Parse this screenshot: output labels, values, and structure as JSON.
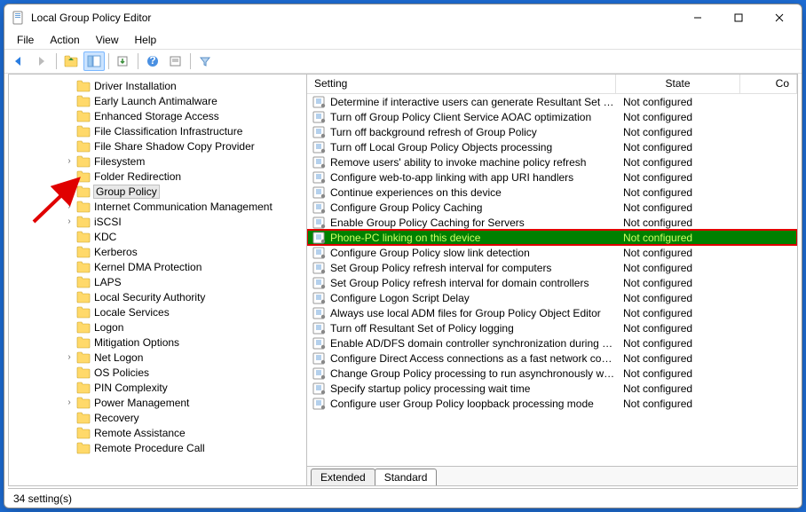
{
  "window": {
    "title": "Local Group Policy Editor"
  },
  "menubar": [
    "File",
    "Action",
    "View",
    "Help"
  ],
  "tree": {
    "items": [
      {
        "label": "Driver Installation",
        "exp": ""
      },
      {
        "label": "Early Launch Antimalware",
        "exp": ""
      },
      {
        "label": "Enhanced Storage Access",
        "exp": ""
      },
      {
        "label": "File Classification Infrastructure",
        "exp": ""
      },
      {
        "label": "File Share Shadow Copy Provider",
        "exp": ""
      },
      {
        "label": "Filesystem",
        "exp": ">"
      },
      {
        "label": "Folder Redirection",
        "exp": ""
      },
      {
        "label": "Group Policy",
        "exp": "",
        "selected": true
      },
      {
        "label": "Internet Communication Management",
        "exp": ">"
      },
      {
        "label": "iSCSI",
        "exp": ">"
      },
      {
        "label": "KDC",
        "exp": ""
      },
      {
        "label": "Kerberos",
        "exp": ""
      },
      {
        "label": "Kernel DMA Protection",
        "exp": ""
      },
      {
        "label": "LAPS",
        "exp": ""
      },
      {
        "label": "Local Security Authority",
        "exp": ""
      },
      {
        "label": "Locale Services",
        "exp": ""
      },
      {
        "label": "Logon",
        "exp": ""
      },
      {
        "label": "Mitigation Options",
        "exp": ""
      },
      {
        "label": "Net Logon",
        "exp": ">"
      },
      {
        "label": "OS Policies",
        "exp": ""
      },
      {
        "label": "PIN Complexity",
        "exp": ""
      },
      {
        "label": "Power Management",
        "exp": ">"
      },
      {
        "label": "Recovery",
        "exp": ""
      },
      {
        "label": "Remote Assistance",
        "exp": ""
      },
      {
        "label": "Remote Procedure Call",
        "exp": ""
      }
    ]
  },
  "list": {
    "columns": {
      "setting": "Setting",
      "state": "State",
      "comment": "Co"
    },
    "rows": [
      {
        "setting": "Determine if interactive users can generate Resultant Set of ...",
        "state": "Not configured"
      },
      {
        "setting": "Turn off Group Policy Client Service AOAC optimization",
        "state": "Not configured"
      },
      {
        "setting": "Turn off background refresh of Group Policy",
        "state": "Not configured"
      },
      {
        "setting": "Turn off Local Group Policy Objects processing",
        "state": "Not configured"
      },
      {
        "setting": "Remove users' ability to invoke machine policy refresh",
        "state": "Not configured"
      },
      {
        "setting": "Configure web-to-app linking with app URI handlers",
        "state": "Not configured"
      },
      {
        "setting": "Continue experiences on this device",
        "state": "Not configured"
      },
      {
        "setting": "Configure Group Policy Caching",
        "state": "Not configured"
      },
      {
        "setting": "Enable Group Policy Caching for Servers",
        "state": "Not configured"
      },
      {
        "setting": "Phone-PC linking on this device",
        "state": "Not configured",
        "selected": true,
        "highlight": true
      },
      {
        "setting": "Configure Group Policy slow link detection",
        "state": "Not configured"
      },
      {
        "setting": "Set Group Policy refresh interval for computers",
        "state": "Not configured"
      },
      {
        "setting": "Set Group Policy refresh interval for domain controllers",
        "state": "Not configured"
      },
      {
        "setting": "Configure Logon Script Delay",
        "state": "Not configured"
      },
      {
        "setting": "Always use local ADM files for Group Policy Object Editor",
        "state": "Not configured"
      },
      {
        "setting": "Turn off Resultant Set of Policy logging",
        "state": "Not configured"
      },
      {
        "setting": "Enable AD/DFS domain controller synchronization during p...",
        "state": "Not configured"
      },
      {
        "setting": "Configure Direct Access connections as a fast network conn...",
        "state": "Not configured"
      },
      {
        "setting": "Change Group Policy processing to run asynchronously wh...",
        "state": "Not configured"
      },
      {
        "setting": "Specify startup policy processing wait time",
        "state": "Not configured"
      },
      {
        "setting": "Configure user Group Policy loopback processing mode",
        "state": "Not configured"
      }
    ]
  },
  "tabs": {
    "extended": "Extended",
    "standard": "Standard"
  },
  "statusbar": "34 setting(s)"
}
